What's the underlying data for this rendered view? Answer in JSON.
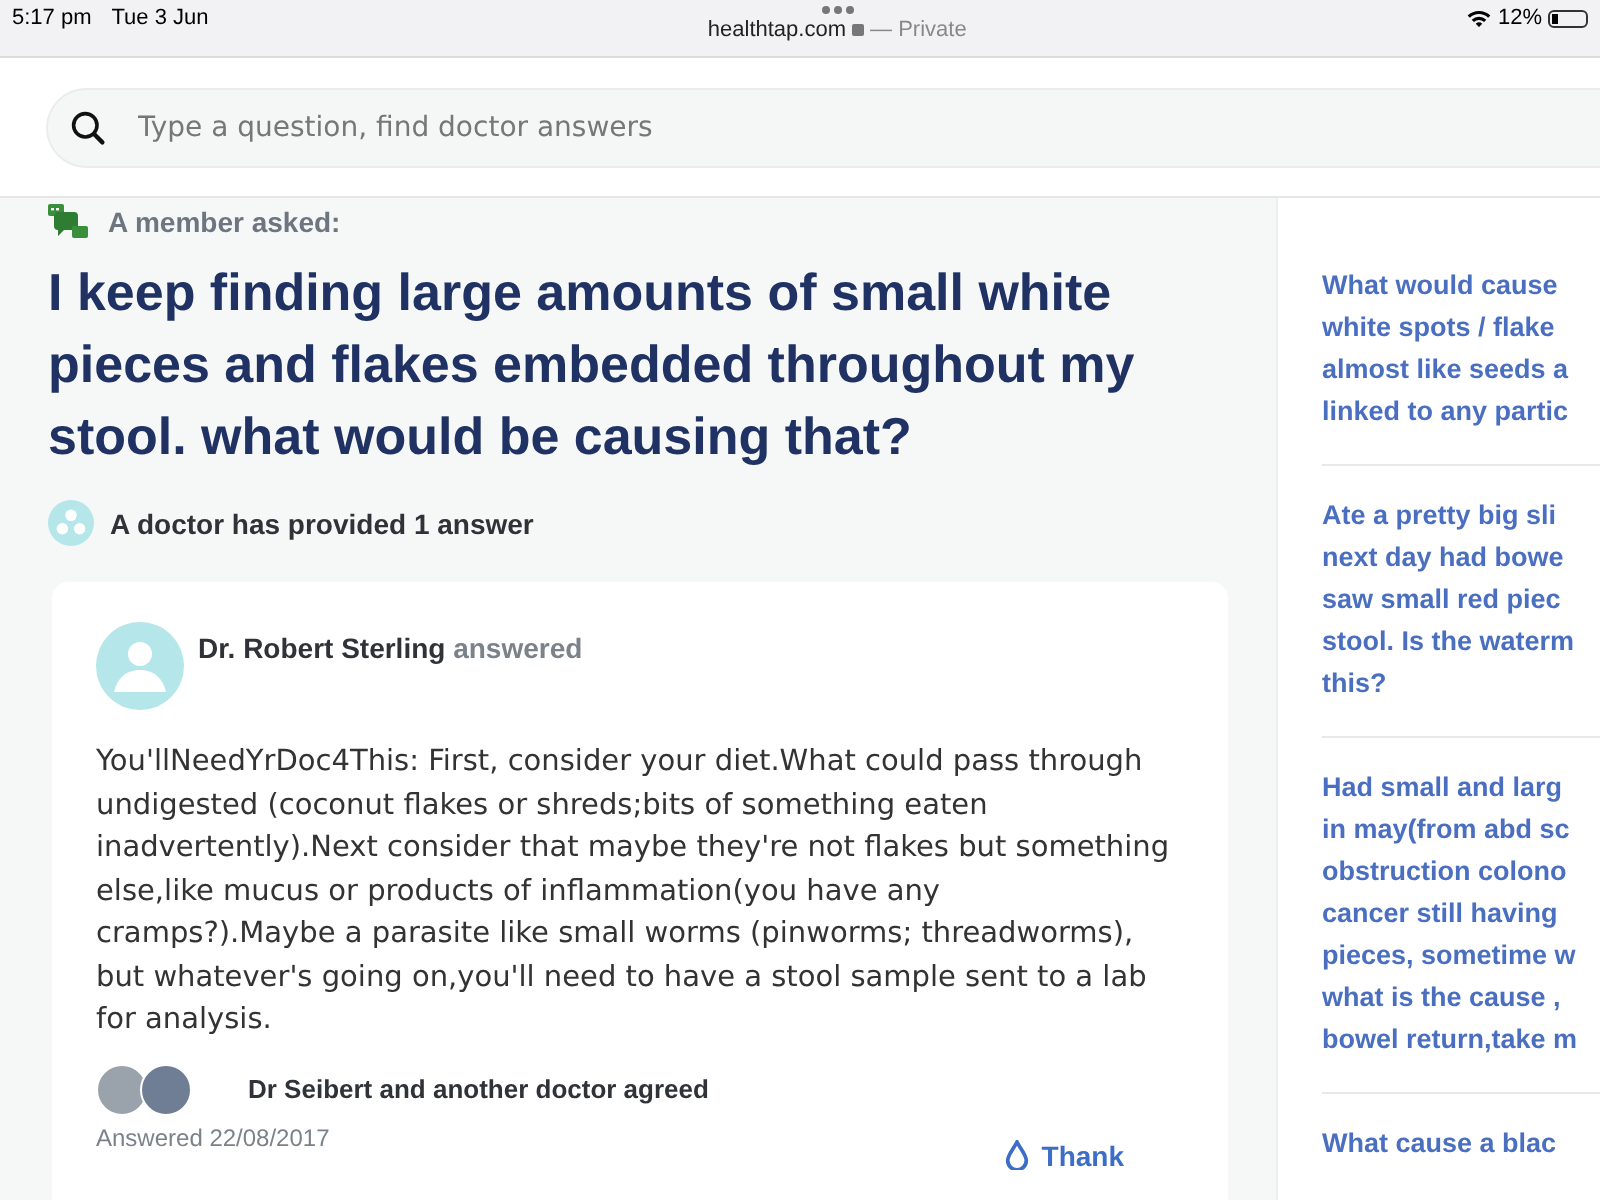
{
  "status_bar": {
    "time": "5:17 pm",
    "date": "Tue 3 Jun",
    "url": "healthtap.com",
    "private_label": "— Private",
    "battery": "12%"
  },
  "search": {
    "placeholder": "Type a question, find doctor answers"
  },
  "question": {
    "asked_label": "A member asked:",
    "title": "I keep finding large amounts of small white pieces and flakes embedded throughout my stool. what would be causing that?",
    "answers_summary": "A doctor has provided 1 answer"
  },
  "answer": {
    "doctor": "Dr. Robert Sterling",
    "verb": "answered",
    "text": "You'llNeedYrDoc4This: First, consider your diet.What could pass through undigested (coconut flakes or shreds;bits of something eaten inadvertently).Next consider that maybe they're not flakes but something else,like mucus or products of inflammation(you have any cramps?).Maybe a parasite like small worms (pinworms; threadworms), but whatever's going on,you'll need to have a stool sample sent to a lab for analysis.",
    "agreed": "Dr Seibert and another doctor agreed",
    "date": "Answered 22/08/2017",
    "thank": "Thank"
  },
  "related": [
    {
      "lines": [
        "What would cause",
        "white spots / flake",
        "almost like seeds a",
        "linked to any partic"
      ]
    },
    {
      "lines": [
        "Ate a pretty big sli",
        "next day had bowe",
        "saw small red piec",
        "stool. Is the waterm",
        "this?"
      ]
    },
    {
      "lines": [
        "Had small and larg",
        "in may(from abd sc",
        "obstruction colono",
        "cancer still having",
        "pieces, sometime w",
        "what is the cause ,",
        "bowel return,take m"
      ]
    },
    {
      "lines": [
        "What cause a blac"
      ]
    }
  ]
}
